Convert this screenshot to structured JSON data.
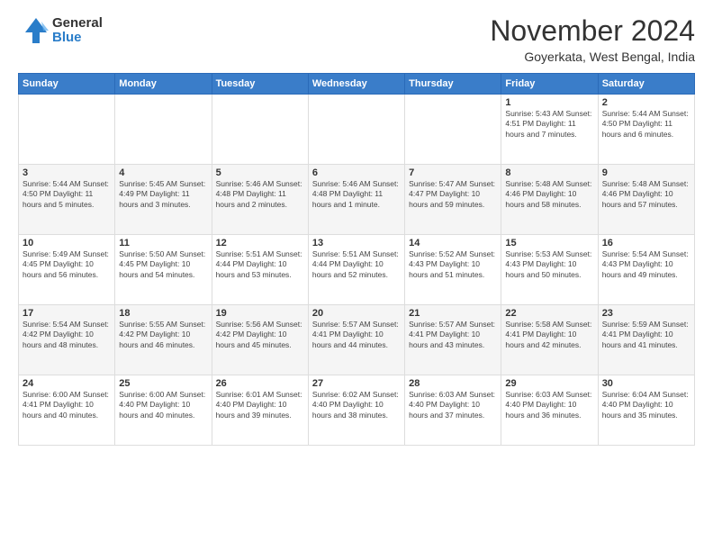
{
  "logo": {
    "general": "General",
    "blue": "Blue"
  },
  "title": "November 2024",
  "location": "Goyerkata, West Bengal, India",
  "weekdays": [
    "Sunday",
    "Monday",
    "Tuesday",
    "Wednesday",
    "Thursday",
    "Friday",
    "Saturday"
  ],
  "weeks": [
    [
      {
        "day": "",
        "info": ""
      },
      {
        "day": "",
        "info": ""
      },
      {
        "day": "",
        "info": ""
      },
      {
        "day": "",
        "info": ""
      },
      {
        "day": "",
        "info": ""
      },
      {
        "day": "1",
        "info": "Sunrise: 5:43 AM\nSunset: 4:51 PM\nDaylight: 11 hours\nand 7 minutes."
      },
      {
        "day": "2",
        "info": "Sunrise: 5:44 AM\nSunset: 4:50 PM\nDaylight: 11 hours\nand 6 minutes."
      }
    ],
    [
      {
        "day": "3",
        "info": "Sunrise: 5:44 AM\nSunset: 4:50 PM\nDaylight: 11 hours\nand 5 minutes."
      },
      {
        "day": "4",
        "info": "Sunrise: 5:45 AM\nSunset: 4:49 PM\nDaylight: 11 hours\nand 3 minutes."
      },
      {
        "day": "5",
        "info": "Sunrise: 5:46 AM\nSunset: 4:48 PM\nDaylight: 11 hours\nand 2 minutes."
      },
      {
        "day": "6",
        "info": "Sunrise: 5:46 AM\nSunset: 4:48 PM\nDaylight: 11 hours\nand 1 minute."
      },
      {
        "day": "7",
        "info": "Sunrise: 5:47 AM\nSunset: 4:47 PM\nDaylight: 10 hours\nand 59 minutes."
      },
      {
        "day": "8",
        "info": "Sunrise: 5:48 AM\nSunset: 4:46 PM\nDaylight: 10 hours\nand 58 minutes."
      },
      {
        "day": "9",
        "info": "Sunrise: 5:48 AM\nSunset: 4:46 PM\nDaylight: 10 hours\nand 57 minutes."
      }
    ],
    [
      {
        "day": "10",
        "info": "Sunrise: 5:49 AM\nSunset: 4:45 PM\nDaylight: 10 hours\nand 56 minutes."
      },
      {
        "day": "11",
        "info": "Sunrise: 5:50 AM\nSunset: 4:45 PM\nDaylight: 10 hours\nand 54 minutes."
      },
      {
        "day": "12",
        "info": "Sunrise: 5:51 AM\nSunset: 4:44 PM\nDaylight: 10 hours\nand 53 minutes."
      },
      {
        "day": "13",
        "info": "Sunrise: 5:51 AM\nSunset: 4:44 PM\nDaylight: 10 hours\nand 52 minutes."
      },
      {
        "day": "14",
        "info": "Sunrise: 5:52 AM\nSunset: 4:43 PM\nDaylight: 10 hours\nand 51 minutes."
      },
      {
        "day": "15",
        "info": "Sunrise: 5:53 AM\nSunset: 4:43 PM\nDaylight: 10 hours\nand 50 minutes."
      },
      {
        "day": "16",
        "info": "Sunrise: 5:54 AM\nSunset: 4:43 PM\nDaylight: 10 hours\nand 49 minutes."
      }
    ],
    [
      {
        "day": "17",
        "info": "Sunrise: 5:54 AM\nSunset: 4:42 PM\nDaylight: 10 hours\nand 48 minutes."
      },
      {
        "day": "18",
        "info": "Sunrise: 5:55 AM\nSunset: 4:42 PM\nDaylight: 10 hours\nand 46 minutes."
      },
      {
        "day": "19",
        "info": "Sunrise: 5:56 AM\nSunset: 4:42 PM\nDaylight: 10 hours\nand 45 minutes."
      },
      {
        "day": "20",
        "info": "Sunrise: 5:57 AM\nSunset: 4:41 PM\nDaylight: 10 hours\nand 44 minutes."
      },
      {
        "day": "21",
        "info": "Sunrise: 5:57 AM\nSunset: 4:41 PM\nDaylight: 10 hours\nand 43 minutes."
      },
      {
        "day": "22",
        "info": "Sunrise: 5:58 AM\nSunset: 4:41 PM\nDaylight: 10 hours\nand 42 minutes."
      },
      {
        "day": "23",
        "info": "Sunrise: 5:59 AM\nSunset: 4:41 PM\nDaylight: 10 hours\nand 41 minutes."
      }
    ],
    [
      {
        "day": "24",
        "info": "Sunrise: 6:00 AM\nSunset: 4:41 PM\nDaylight: 10 hours\nand 40 minutes."
      },
      {
        "day": "25",
        "info": "Sunrise: 6:00 AM\nSunset: 4:40 PM\nDaylight: 10 hours\nand 40 minutes."
      },
      {
        "day": "26",
        "info": "Sunrise: 6:01 AM\nSunset: 4:40 PM\nDaylight: 10 hours\nand 39 minutes."
      },
      {
        "day": "27",
        "info": "Sunrise: 6:02 AM\nSunset: 4:40 PM\nDaylight: 10 hours\nand 38 minutes."
      },
      {
        "day": "28",
        "info": "Sunrise: 6:03 AM\nSunset: 4:40 PM\nDaylight: 10 hours\nand 37 minutes."
      },
      {
        "day": "29",
        "info": "Sunrise: 6:03 AM\nSunset: 4:40 PM\nDaylight: 10 hours\nand 36 minutes."
      },
      {
        "day": "30",
        "info": "Sunrise: 6:04 AM\nSunset: 4:40 PM\nDaylight: 10 hours\nand 35 minutes."
      }
    ]
  ]
}
